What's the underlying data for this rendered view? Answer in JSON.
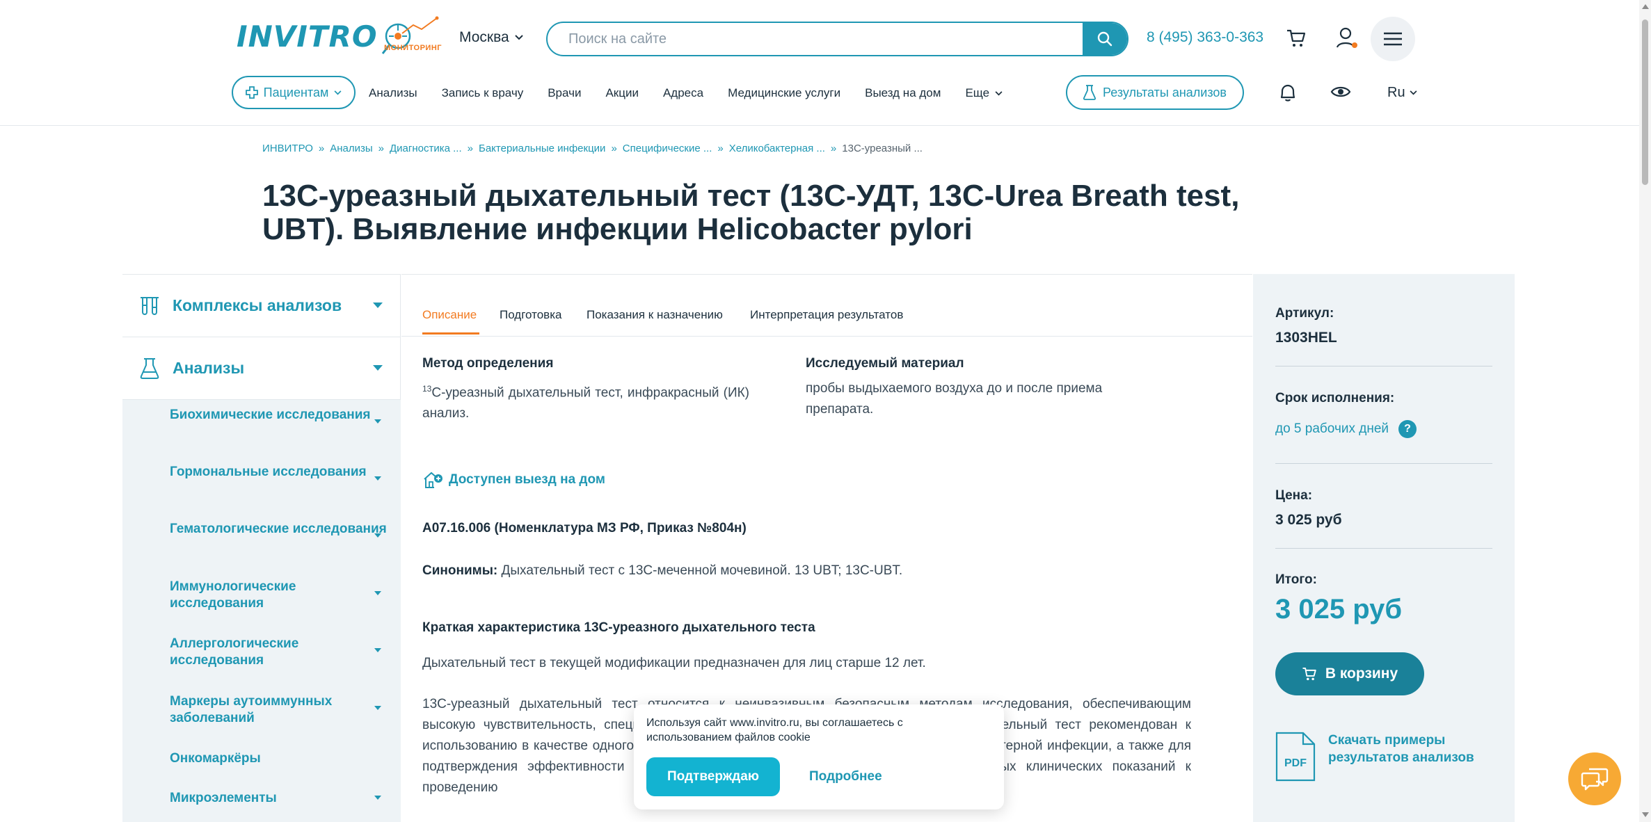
{
  "header": {
    "logo": "INVITRO",
    "monitoring_label": "МОНИТОРИНГ",
    "city": "Москва",
    "search_placeholder": "Поиск на сайте",
    "phone": "8 (495) 363-0-363",
    "patients_label": "Пациентам",
    "nav": [
      "Анализы",
      "Запись к врачу",
      "Врачи",
      "Акции",
      "Адреса",
      "Медицинские услуги",
      "Выезд на дом",
      "Еще"
    ],
    "results_label": "Результаты анализов",
    "lang": "Ru"
  },
  "breadcrumb": [
    "ИНВИТРО",
    "Анализы",
    "Диагностика ...",
    "Бактериальные инфекции",
    "Специфические ...",
    "Хеликобактерная ...",
    "13С-уреазный ..."
  ],
  "page_title": "13С-уреазный дыхательный тест (13С-УДТ, 13С-Urea Breath test, UBT). Выявление инфекции Helicobacter pylori",
  "sidebar": {
    "sections": [
      {
        "label": "Комплексы анализов",
        "icon": "test-tubes-icon"
      },
      {
        "label": "Анализы",
        "icon": "flask-icon"
      }
    ],
    "items": [
      {
        "label": "Биохимические исследования"
      },
      {
        "label": "Гормональные исследования"
      },
      {
        "label": "Гематологические исследования"
      },
      {
        "label": "Иммунологические исследования"
      },
      {
        "label": "Аллергологические исследования"
      },
      {
        "label": "Маркеры аутоиммунных заболеваний"
      },
      {
        "label": "Онкомаркёры"
      },
      {
        "label": "Микроэлементы"
      }
    ]
  },
  "tabs": [
    "Описание",
    "Подготовка",
    "Показания к назначению",
    "Интерпретация результатов"
  ],
  "content": {
    "method_label": "Метод определения",
    "method_sup": "13",
    "method_text": "С-уреазный дыхательный тест, инфракрасный (ИК) анализ.",
    "material_label": "Исследуемый материал",
    "material_text": "пробы выдыхаемого воздуха до и после приема препарата.",
    "home_visit": "Доступен выезд на дом",
    "code": "A07.16.006 (Номенклатура МЗ РФ, Приказ №804н)",
    "synonyms_label": "Синонимы:",
    "synonyms_text": " Дыхательный тест с 13С-меченной мочевиной. 13 UBT; 13С-UBT.",
    "brief_title": "Краткая характеристика 13С-уреазного дыхательного теста",
    "para1": "Дыхательный тест в текущей модификации предназначен для лиц  старше 12 лет.",
    "para2": "13С-уреазный дыхательный тест относится к неинвазивным безопасным методам исследования, обеспечивающим высокую чувствительность, специфичность и точность результатов. 13С-уреазный дыхательный тест рекомендован к использованию в качестве одного из основных методов в первичной диагностике хеликобактерной инфекции, а также для подтверждения эффективности эрадикационной терапии при отсутствии дополнительных клинических показаний к проведению"
  },
  "right_panel": {
    "article_label": "Артикул:",
    "article_value": "1303HEL",
    "term_label": "Срок исполнения:",
    "term_value": "до 5 рабочих дней",
    "term_help": "?",
    "price_label": "Цена:",
    "price_value": "3 025 руб",
    "total_label": "Итого:",
    "total_value": "3 025 руб",
    "cart_button": "В корзину",
    "pdf_badge": "PDF",
    "pdf_link": "Скачать примеры результатов анализов"
  },
  "cookie": {
    "text": "Используя сайт www.invitro.ru, вы соглашаетесь с использованием файлов cookie",
    "accept": "Подтверждаю",
    "more": "Подробнее"
  },
  "colors": {
    "brand": "#1f97b3",
    "accent": "#f27b21",
    "panel_bg": "#eef3f6",
    "chat": "#f7a934"
  }
}
